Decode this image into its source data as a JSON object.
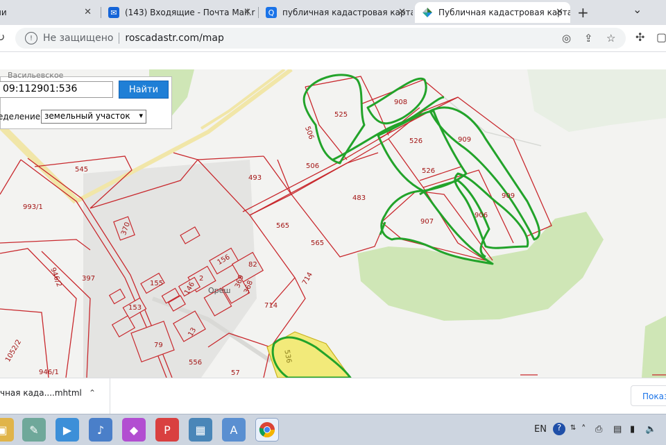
{
  "browser": {
    "tabs": [
      {
        "title": "ни",
        "favicon": "generic-icon"
      },
      {
        "title": "(143) Входящие - Почта Mail.r",
        "favicon": "mail-icon"
      },
      {
        "title": "публичная кадастровая карта",
        "favicon": "search-icon"
      },
      {
        "title": "Публичная кадастровая карта",
        "favicon": "pkk-logo-icon",
        "active": true
      }
    ],
    "address": {
      "security": "Не защищено",
      "url": "roscadastr.com/map"
    }
  },
  "map": {
    "locality_label": "Васильевское",
    "search_value": "09:112901:536",
    "find_label": "Найти",
    "definition_label": "еделение:",
    "definition_value": "земельный участок",
    "village_label": "Ореш",
    "parcels": [
      "525",
      "908",
      "506",
      "526",
      "909",
      "506",
      "493",
      "545",
      "526",
      "483",
      "909",
      "993/1",
      "907",
      "906",
      "565",
      "370",
      "565",
      "946/2",
      "397",
      "156",
      "82",
      "2",
      "155",
      "146",
      "369",
      "368",
      "714",
      "714",
      "153",
      "13",
      "79",
      "1052/2",
      "556",
      "946/1",
      "536",
      "57"
    ]
  },
  "downloads": {
    "file": "чная када....mhtml",
    "show_all": "Показ"
  },
  "taskbar": {
    "lang": "EN"
  },
  "colors": {
    "parcel": "#c8282d",
    "outline": "#22a32a",
    "selected": "#f2ea7a",
    "link": "#1a73e8"
  }
}
